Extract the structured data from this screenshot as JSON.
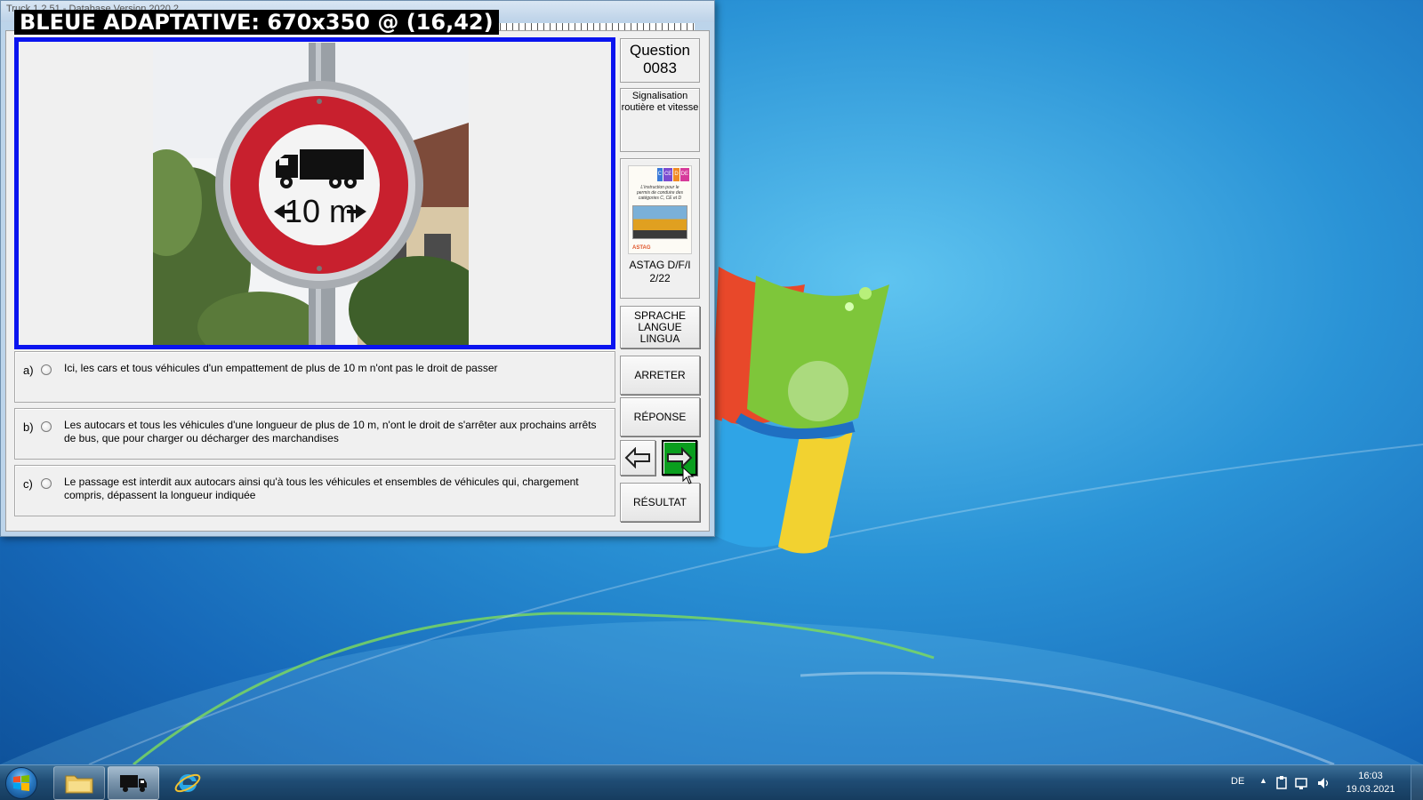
{
  "window": {
    "title": "Truck 1.2.51 - Database Version 2020.2",
    "overlay_label": "BLEUE ADAPTATIVE: 670x350 @ (16,42)"
  },
  "sign": {
    "distance_label": "10 m"
  },
  "question": {
    "label": "Question",
    "number": "0083",
    "category": "Signalisation routière et vitesse"
  },
  "book": {
    "cover_badges": [
      "C",
      "CE",
      "D",
      "DE"
    ],
    "cover_title": "L'instruction pour le permis de conduire des catégories C, CE et D",
    "cover_publisher": "ASTAG",
    "caption_line1": "ASTAG D/F/I",
    "caption_line2": "2/22"
  },
  "answers": [
    {
      "letter": "a)",
      "text": "Ici, les cars et tous véhicules d'un empattement de plus de 10 m n'ont pas le droit de passer"
    },
    {
      "letter": "b)",
      "text": "Les autocars et tous les véhicules d'une longueur de plus de 10 m, n'ont le droit de s'arrêter aux prochains arrêts de bus, que pour charger ou décharger des marchandises"
    },
    {
      "letter": "c)",
      "text": "Le passage est interdit aux autocars ainsi qu'à tous les véhicules et ensembles de véhicules qui, chargement compris, dépassent la longueur indiquée"
    }
  ],
  "buttons": {
    "language_lines": [
      "SPRACHE",
      "LANGUE",
      "LINGUA"
    ],
    "stop": "ARRETER",
    "answer": "RÉPONSE",
    "result": "RÉSULTAT",
    "prev_icon": "arrow-left-icon",
    "next_icon": "arrow-right-icon"
  },
  "taskbar": {
    "apps": [
      "folder-icon",
      "truck-app-icon",
      "internet-explorer-icon"
    ],
    "language": "DE",
    "time": "16:03",
    "date": "19.03.2021"
  },
  "colors": {
    "image_frame": "#0a14ef",
    "next_button": "#0a9e1e",
    "desktop": "#1f82cf"
  }
}
